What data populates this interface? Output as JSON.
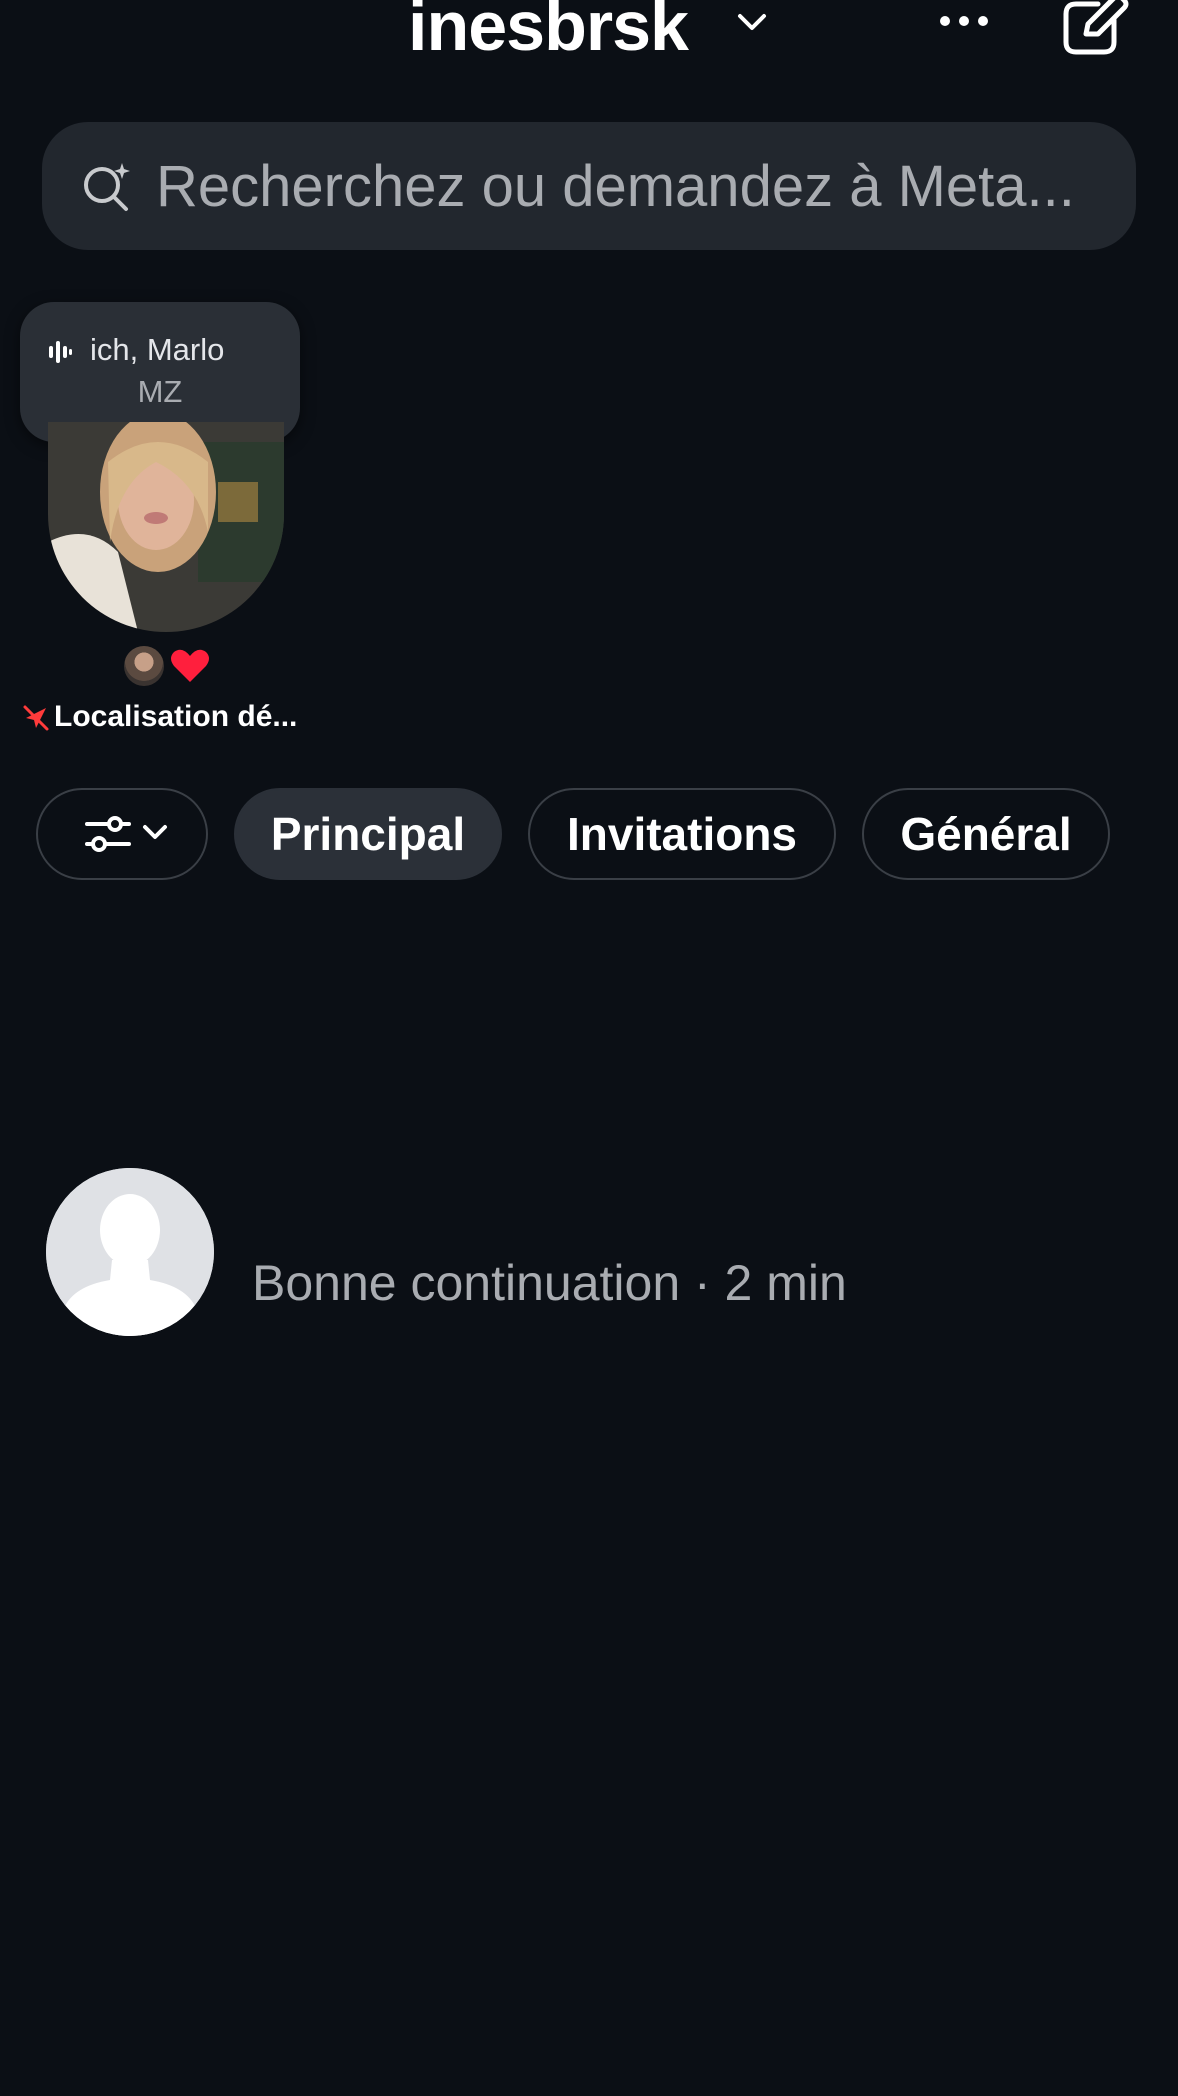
{
  "header": {
    "account_name": "inesbrsk"
  },
  "search": {
    "placeholder": "Recherchez ou demandez à Meta..."
  },
  "note": {
    "line1": "ich, Marlo",
    "line2": "MZ"
  },
  "story": {
    "location_label": "Localisation dé..."
  },
  "filters": {
    "chips": [
      {
        "label": "Principal",
        "selected": true
      },
      {
        "label": "Invitations",
        "selected": false
      },
      {
        "label": "Général",
        "selected": false
      }
    ]
  },
  "messages": [
    {
      "preview": "Bonne continuation · 2 min"
    }
  ],
  "colors": {
    "background": "#0b0f15",
    "search_bg": "#22272e",
    "chip_selected_bg": "#2b3038",
    "heart": "#ff1f3d",
    "location_icon": "#ff3b3b"
  },
  "icons": [
    "chevron-down-icon",
    "more-icon",
    "compose-icon",
    "meta-ai-search-icon",
    "audio-wave-icon",
    "heart-icon",
    "location-off-icon",
    "filter-sliders-icon",
    "default-avatar-icon"
  ]
}
